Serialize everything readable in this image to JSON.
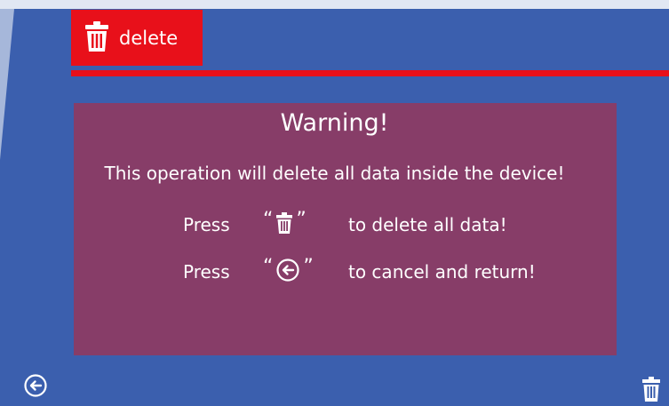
{
  "header": {
    "label": "delete"
  },
  "dialog": {
    "title": "Warning!",
    "message": "This operation will delete all data inside the device!",
    "lines": [
      {
        "press": "Press",
        "open_quote": "“",
        "close_quote": "”",
        "icon": "trash-icon",
        "text": "to delete all data!"
      },
      {
        "press": "Press",
        "open_quote": "“",
        "close_quote": "”",
        "icon": "back-arrow-circle-icon",
        "text": "to cancel and return!"
      }
    ]
  },
  "footer": {
    "back_icon": "back-arrow-circle-icon",
    "delete_icon": "trash-icon"
  },
  "colors": {
    "background": "#3b5fae",
    "accent_red": "#e8101a",
    "dialog_panel": "#873d68",
    "text": "#ffffff"
  }
}
